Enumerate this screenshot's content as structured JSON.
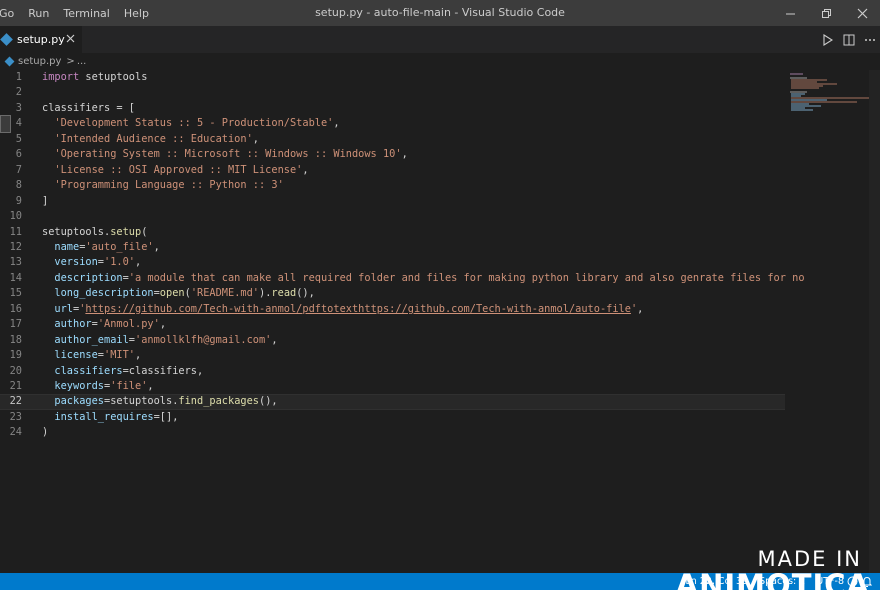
{
  "menu": [
    "Go",
    "Run",
    "Terminal",
    "Help"
  ],
  "window_title": "setup.py - auto-file-main - Visual Studio Code",
  "tab": {
    "label": "setup.py"
  },
  "breadcrumb": {
    "file": "setup.py",
    "sep": ">",
    "more": "..."
  },
  "editor": {
    "current_line": 22,
    "lines": [
      [
        [
          "kw",
          "import"
        ],
        [
          "var",
          " setuptools"
        ]
      ],
      [],
      [
        [
          "var",
          "classifiers = ["
        ]
      ],
      [
        [
          "str",
          "  'Development Status :: 5 - Production/Stable'"
        ],
        [
          "var",
          ","
        ]
      ],
      [
        [
          "str",
          "  'Intended Audience :: Education'"
        ],
        [
          "var",
          ","
        ]
      ],
      [
        [
          "str",
          "  'Operating System :: Microsoft :: Windows :: Windows 10'"
        ],
        [
          "var",
          ","
        ]
      ],
      [
        [
          "str",
          "  'License :: OSI Approved :: MIT License'"
        ],
        [
          "var",
          ","
        ]
      ],
      [
        [
          "str",
          "  'Programming Language :: Python :: 3'"
        ]
      ],
      [
        [
          "var",
          "]"
        ]
      ],
      [],
      [
        [
          "var",
          "setuptools."
        ],
        [
          "fn",
          "setup"
        ],
        [
          "var",
          "("
        ]
      ],
      [
        [
          "par",
          "  name"
        ],
        [
          "var",
          "="
        ],
        [
          "str",
          "'auto_file'"
        ],
        [
          "var",
          ","
        ]
      ],
      [
        [
          "par",
          "  version"
        ],
        [
          "var",
          "="
        ],
        [
          "str",
          "'1.0'"
        ],
        [
          "var",
          ","
        ]
      ],
      [
        [
          "par",
          "  description"
        ],
        [
          "var",
          "="
        ],
        [
          "str",
          "'a module that can make all required folder and files for making python library and also genrate files for no"
        ]
      ],
      [
        [
          "par",
          "  long_description"
        ],
        [
          "var",
          "="
        ],
        [
          "fn",
          "open"
        ],
        [
          "var",
          "("
        ],
        [
          "str",
          "'README.md'"
        ],
        [
          "var",
          ")."
        ],
        [
          "fn",
          "read"
        ],
        [
          "var",
          "(),"
        ]
      ],
      [
        [
          "par",
          "  url"
        ],
        [
          "var",
          "="
        ],
        [
          "str",
          "'"
        ],
        [
          "url",
          "https://github.com/Tech-with-anmol/pdftotexthttps://github.com/Tech-with-anmol/auto-file"
        ],
        [
          "str",
          "'"
        ],
        [
          "var",
          ","
        ]
      ],
      [
        [
          "par",
          "  author"
        ],
        [
          "var",
          "="
        ],
        [
          "str",
          "'Anmol.py'"
        ],
        [
          "var",
          ","
        ]
      ],
      [
        [
          "par",
          "  author_email"
        ],
        [
          "var",
          "="
        ],
        [
          "str",
          "'anmollklfh@gmail.com'"
        ],
        [
          "var",
          ","
        ]
      ],
      [
        [
          "par",
          "  license"
        ],
        [
          "var",
          "="
        ],
        [
          "str",
          "'MIT'"
        ],
        [
          "var",
          ","
        ]
      ],
      [
        [
          "par",
          "  classifiers"
        ],
        [
          "var",
          "=classifiers,"
        ]
      ],
      [
        [
          "par",
          "  keywords"
        ],
        [
          "var",
          "="
        ],
        [
          "str",
          "'file'"
        ],
        [
          "var",
          ","
        ]
      ],
      [
        [
          "par",
          "  packages"
        ],
        [
          "var",
          "=setuptools."
        ],
        [
          "fn",
          "find_packages"
        ],
        [
          "var",
          "(),"
        ]
      ],
      [
        [
          "par",
          "  install_requires"
        ],
        [
          "var",
          "=[],"
        ]
      ],
      [
        [
          "var",
          ")"
        ]
      ]
    ]
  },
  "status": {
    "position": "Ln 22, Col 39",
    "spaces": "Spaces: 2",
    "encoding": "UTF-8"
  },
  "watermark": {
    "line1": "MADE IN",
    "line2": "ANIMOTICA"
  },
  "icons": [
    "run-icon",
    "split-editor-icon",
    "close-icon",
    "minimize-icon",
    "restore-icon",
    "python-file-icon",
    "feedback-icon",
    "bell-icon"
  ],
  "colors": {
    "statusbar": "#007acc",
    "string": "#ce9178",
    "keyword": "#c586c0",
    "param": "#9cdcfe",
    "function": "#dcdcaa"
  }
}
